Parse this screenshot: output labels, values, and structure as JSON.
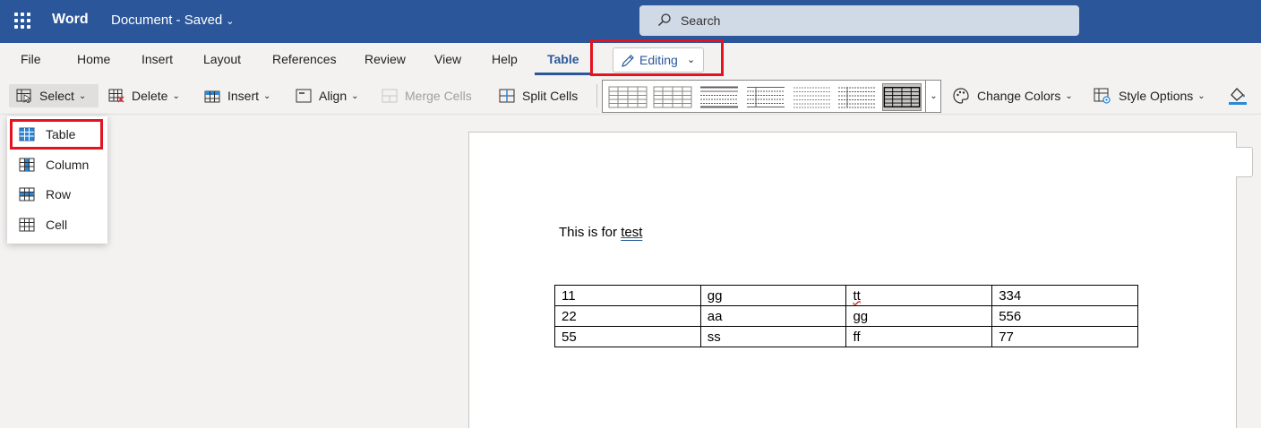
{
  "titlebar": {
    "app_name": "Word",
    "doc_title": "Document",
    "separator": "-",
    "status": "Saved",
    "search_placeholder": "Search"
  },
  "menu": {
    "tabs": [
      "File",
      "Home",
      "Insert",
      "Layout",
      "References",
      "Review",
      "View",
      "Help",
      "Table"
    ],
    "active_tab": "Table",
    "editing_label": "Editing"
  },
  "toolbar": {
    "select": "Select",
    "delete": "Delete",
    "insert": "Insert",
    "align": "Align",
    "merge_cells": "Merge Cells",
    "split_cells": "Split Cells",
    "change_colors": "Change Colors",
    "style_options": "Style Options"
  },
  "select_menu": {
    "items": [
      "Table",
      "Column",
      "Row",
      "Cell"
    ],
    "highlighted": "Table"
  },
  "document": {
    "paragraph_prefix": "This is for ",
    "paragraph_word": "test",
    "table": [
      [
        "11",
        "gg",
        "tt",
        "334"
      ],
      [
        "22",
        "aa",
        "gg",
        "556"
      ],
      [
        "55",
        "ss",
        "ff",
        "77"
      ]
    ]
  },
  "colors": {
    "brand": "#2b579a",
    "highlight_box": "#e3131f",
    "spell_error": "#d13438"
  }
}
